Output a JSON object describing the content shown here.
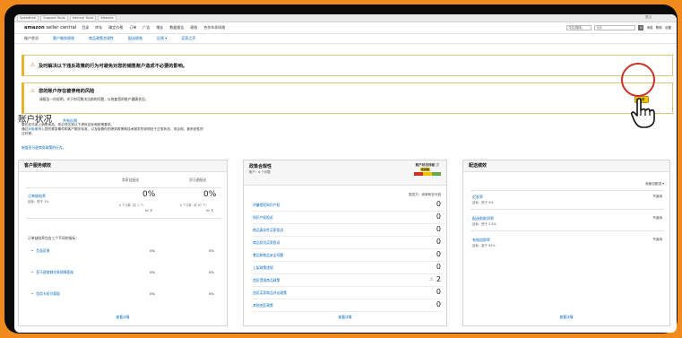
{
  "browser": {
    "bookmarks": [
      "Speedtrial",
      "Support Tools",
      "Internal Tools",
      "Website"
    ],
    "right_text": "退出"
  },
  "topnav": {
    "logo_main": "amazon",
    "logo_sub": " seller central",
    "items": [
      "目录",
      "库存",
      "确定价格",
      "订单",
      "广告",
      "增长",
      "数据报告",
      "绩效",
      "合作伙伴网络"
    ],
    "selector": "中文(简体)",
    "search_placeholder": "搜索",
    "search_button": "Q",
    "links": [
      "消息",
      "帮助",
      "设置"
    ]
  },
  "subnav": {
    "items": [
      "账户状况",
      "客户服务绩效",
      "商品政策合规性",
      "配送绩效",
      "反馈 ▾",
      "买家之声"
    ]
  },
  "alert1": {
    "text": "及时解决以下违反政策的行为可避免对您的销售账户造成不必要的影响。"
  },
  "alert2": {
    "title": "您的账户存在被停用的风险",
    "body": "请报告一份说明，关于你可解决当前的问题，以恢复您的账户健康状况。",
    "button": "查看"
  },
  "account": {
    "title": "账户状况",
    "link": "共有反馈",
    "desc_1": "要在亚马逊上销售商品，您必须达到以下绩效目标和政策要求。",
    "desc_2_pre": "通过",
    "desc_2_link": "对卖家",
    "desc_2_post": "列入您的紧急事件和客户服务标准，以及查看你的绩效政策和技术服务的说明处于正常状态，或合规，被系统性的",
    "desc_3": "过时等。",
    "policy_link": "新版亚马逊商务政策的行为。"
  },
  "customer_service": {
    "title": "客户服务绩效",
    "col_seller": "卖家自配送",
    "col_amazon": "亚马逊配送",
    "metric_name": "订单缺陷率",
    "metric_target": "目标：低于 1%",
    "seller_value": "0%",
    "seller_detail": "0 个订单（共 1 个）",
    "seller_days": "60 天",
    "amazon_value": "0%",
    "amazon_detail": "0 个订单（共 67 个）",
    "amazon_days": "60 天",
    "intro": "订单缺陷率包含三个不同的指标：",
    "sub_metrics": [
      {
        "name": "负面反馈",
        "seller": "0%",
        "amazon": "0%"
      },
      {
        "name": "亚马逊商城交易保障索赔",
        "seller": "0%",
        "amazon": "0%"
      },
      {
        "name": "信用卡拒付索赔",
        "seller": "0%",
        "amazon": "0%"
      }
    ],
    "footer": "查看详情"
  },
  "policy_compliance": {
    "title": "政策合规性",
    "subtitle": "账户：8 个问题",
    "status_label": "账户状况评级 ⓘ",
    "tag": "有风险",
    "bar_colors": [
      "#d03025",
      "#f2c200",
      "#6aa84f"
    ],
    "row_header": "配送方：卖家和亚马逊",
    "rows": [
      {
        "name": "涉嫌侵犯知识产权",
        "value": "0",
        "warn": false
      },
      {
        "name": "知识产权投诉",
        "value": "0",
        "warn": false
      },
      {
        "name": "商品真实性买家投诉",
        "value": "0",
        "warn": false
      },
      {
        "name": "商品状况买家投诉",
        "value": "0",
        "warn": false
      },
      {
        "name": "食品和商品安全问题",
        "value": "0",
        "warn": false
      },
      {
        "name": "上架政策违规",
        "value": "0",
        "warn": false
      },
      {
        "name": "违反受限商品政策",
        "value": "2",
        "warn": true
      },
      {
        "name": "违反买家商品评论政策",
        "value": "0",
        "warn": false
      },
      {
        "name": "其他违反政策",
        "value": "0",
        "warn": false
      }
    ],
    "footer": "查看详情"
  },
  "shipping": {
    "title": "配送绩效",
    "status": "卖家自配送 ▾",
    "metrics": [
      {
        "name": "迟发率",
        "target": "目标：低于 4%",
        "value": "不适用"
      },
      {
        "name": "配送前取消率",
        "target": "目标：低于 2.5%",
        "value": "不适用"
      },
      {
        "name": "有效追踪率",
        "target": "目标：高于 95%",
        "value": "不适用"
      }
    ],
    "footer": "查看详情"
  }
}
